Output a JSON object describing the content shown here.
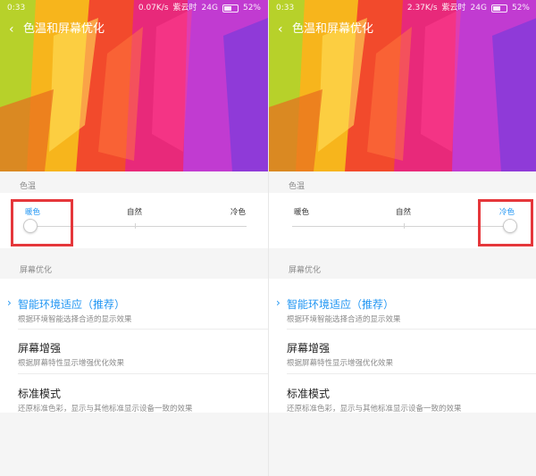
{
  "screens": [
    {
      "status": {
        "time": "0:33",
        "speed": "0.07K/s",
        "carrier": "紫云时",
        "network": "24G",
        "battery": "52%"
      },
      "title": "色温和屏幕优化",
      "color_temp": {
        "section_label": "色温",
        "labels": {
          "warm": "暖色",
          "natural": "自然",
          "cool": "冷色"
        },
        "selected": "暖色",
        "slider_value": 0
      },
      "optimization": {
        "section_label": "屏幕优化",
        "items": [
          {
            "name": "智能环境适应（推荐）",
            "desc": "根据环境智能选择合适的显示效果",
            "selected": true
          },
          {
            "name": "屏幕增强",
            "desc": "根据屏幕特性显示增强优化效果",
            "selected": false
          },
          {
            "name": "标准模式",
            "desc": "还原标准色彩，显示与其他标准显示设备一致的效果",
            "selected": false
          }
        ]
      }
    },
    {
      "status": {
        "time": "0:33",
        "speed": "2.37K/s",
        "carrier": "紫云时",
        "network": "24G",
        "battery": "52%"
      },
      "title": "色温和屏幕优化",
      "color_temp": {
        "section_label": "色温",
        "labels": {
          "warm": "暖色",
          "natural": "自然",
          "cool": "冷色"
        },
        "selected": "冷色",
        "slider_value": 1
      },
      "optimization": {
        "section_label": "屏幕优化",
        "items": [
          {
            "name": "智能环境适应（推荐）",
            "desc": "根据环境智能选择合适的显示效果",
            "selected": true
          },
          {
            "name": "屏幕增强",
            "desc": "根据屏幕特性显示增强优化效果",
            "selected": false
          },
          {
            "name": "标准模式",
            "desc": "还原标准色彩，显示与其他标准显示设备一致的效果",
            "selected": false
          }
        ]
      }
    }
  ],
  "colors": {
    "accent": "#2196f3",
    "highlight": "#e5373b"
  },
  "icons": {
    "back": "back-arrow-icon",
    "check": "chevron-right-icon",
    "battery": "battery-icon"
  }
}
